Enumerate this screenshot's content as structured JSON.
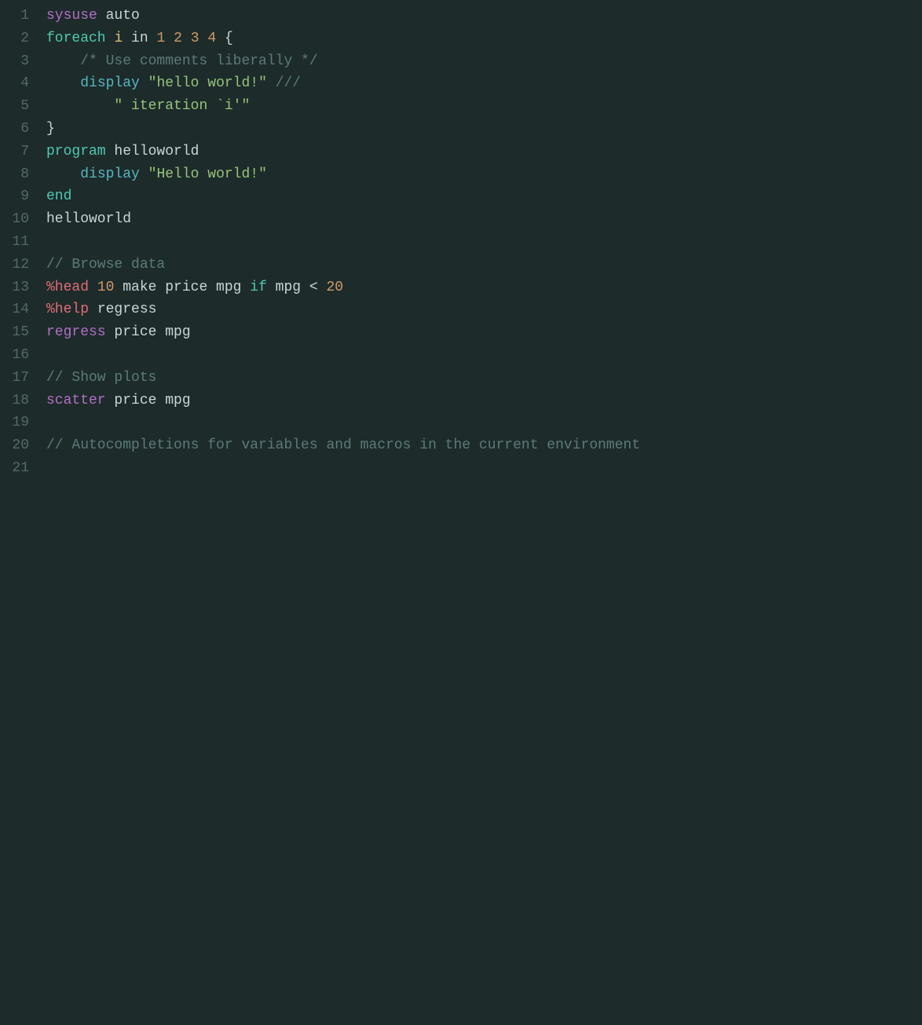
{
  "editor": {
    "background": "#1e2b2b",
    "lines": [
      {
        "number": "1",
        "tokens": [
          {
            "text": "sysuse",
            "class": "kw-purple"
          },
          {
            "text": " auto",
            "class": "normal"
          }
        ]
      },
      {
        "number": "2",
        "tokens": [
          {
            "text": "foreach",
            "class": "kw-teal"
          },
          {
            "text": " ",
            "class": "normal"
          },
          {
            "text": "i",
            "class": "kw-yellow"
          },
          {
            "text": " in ",
            "class": "normal"
          },
          {
            "text": "1",
            "class": "num"
          },
          {
            "text": " ",
            "class": "normal"
          },
          {
            "text": "2",
            "class": "num"
          },
          {
            "text": " ",
            "class": "normal"
          },
          {
            "text": "3",
            "class": "num"
          },
          {
            "text": " ",
            "class": "normal"
          },
          {
            "text": "4",
            "class": "num"
          },
          {
            "text": " {",
            "class": "normal"
          }
        ]
      },
      {
        "number": "3",
        "tokens": [
          {
            "text": "    /* Use comments liberally */",
            "class": "comment"
          }
        ]
      },
      {
        "number": "4",
        "tokens": [
          {
            "text": "    ",
            "class": "normal"
          },
          {
            "text": "display",
            "class": "kw-cyan"
          },
          {
            "text": " ",
            "class": "normal"
          },
          {
            "text": "\"hello world!\"",
            "class": "str"
          },
          {
            "text": " ///",
            "class": "comment"
          }
        ]
      },
      {
        "number": "5",
        "tokens": [
          {
            "text": "        ",
            "class": "normal"
          },
          {
            "text": "\"",
            "class": "str"
          },
          {
            "text": " iteration ",
            "class": "str"
          },
          {
            "text": "`i'",
            "class": "backtick"
          },
          {
            "text": "\"",
            "class": "str"
          }
        ]
      },
      {
        "number": "6",
        "tokens": [
          {
            "text": "}",
            "class": "normal"
          }
        ]
      },
      {
        "number": "7",
        "tokens": [
          {
            "text": "program",
            "class": "kw-teal"
          },
          {
            "text": " helloworld",
            "class": "normal"
          }
        ]
      },
      {
        "number": "8",
        "tokens": [
          {
            "text": "    ",
            "class": "normal"
          },
          {
            "text": "display",
            "class": "kw-cyan"
          },
          {
            "text": " ",
            "class": "normal"
          },
          {
            "text": "\"Hello world!\"",
            "class": "str"
          }
        ]
      },
      {
        "number": "9",
        "tokens": [
          {
            "text": "end",
            "class": "kw-teal"
          }
        ]
      },
      {
        "number": "10",
        "tokens": [
          {
            "text": "helloworld",
            "class": "normal"
          }
        ]
      },
      {
        "number": "11",
        "tokens": []
      },
      {
        "number": "12",
        "tokens": [
          {
            "text": "// Browse data",
            "class": "comment"
          }
        ]
      },
      {
        "number": "13",
        "tokens": [
          {
            "text": "%head",
            "class": "macro"
          },
          {
            "text": " ",
            "class": "normal"
          },
          {
            "text": "10",
            "class": "num"
          },
          {
            "text": " make price mpg ",
            "class": "normal"
          },
          {
            "text": "if",
            "class": "kw-teal"
          },
          {
            "text": " mpg < ",
            "class": "normal"
          },
          {
            "text": "20",
            "class": "num"
          }
        ]
      },
      {
        "number": "14",
        "tokens": [
          {
            "text": "%help",
            "class": "macro"
          },
          {
            "text": " regress",
            "class": "normal"
          }
        ]
      },
      {
        "number": "15",
        "tokens": [
          {
            "text": "regress",
            "class": "kw-purple"
          },
          {
            "text": " price mpg",
            "class": "normal"
          }
        ]
      },
      {
        "number": "16",
        "tokens": []
      },
      {
        "number": "17",
        "tokens": [
          {
            "text": "// Show plots",
            "class": "comment"
          }
        ]
      },
      {
        "number": "18",
        "tokens": [
          {
            "text": "scatter",
            "class": "kw-purple"
          },
          {
            "text": " price mpg",
            "class": "normal"
          }
        ]
      },
      {
        "number": "19",
        "tokens": []
      },
      {
        "number": "20",
        "tokens": [
          {
            "text": "// Autocompletions for variables and macros in the current environment",
            "class": "comment"
          }
        ]
      },
      {
        "number": "21",
        "tokens": []
      }
    ]
  }
}
